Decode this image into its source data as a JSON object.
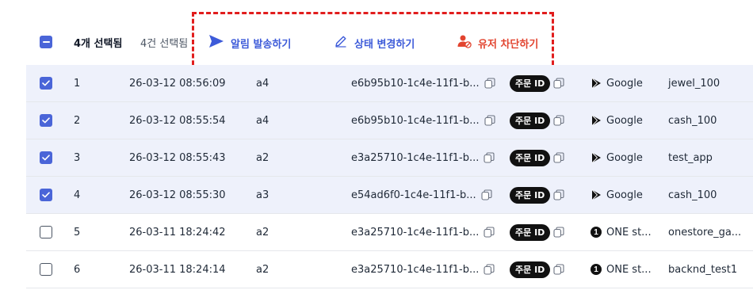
{
  "toolbar": {
    "selected_count": "4개 선택됨",
    "total_selected": "4건 선택됨",
    "actions": {
      "send_notification": "알림 발송하기",
      "change_status": "상태 변경하기",
      "block_user": "유저 차단하기"
    },
    "colors": {
      "primary": "#3d5bd9",
      "danger": "#e2442f",
      "highlight_border": "#e11d1d"
    }
  },
  "rows": [
    {
      "selected": true,
      "num": "1",
      "date": "26-03-12 08:56:09",
      "user": "a4",
      "tx": "e6b95b10-1c4e-11f1-b...",
      "order_badge": "주문 ID",
      "store_icon": "google-play-icon",
      "store": "Google",
      "product": "jewel_100"
    },
    {
      "selected": true,
      "num": "2",
      "date": "26-03-12 08:55:54",
      "user": "a4",
      "tx": "e6b95b10-1c4e-11f1-b...",
      "order_badge": "주문 ID",
      "store_icon": "google-play-icon",
      "store": "Google",
      "product": "cash_100"
    },
    {
      "selected": true,
      "num": "3",
      "date": "26-03-12 08:55:43",
      "user": "a2",
      "tx": "e3a25710-1c4e-11f1-b...",
      "order_badge": "주문 ID",
      "store_icon": "google-play-icon",
      "store": "Google",
      "product": "test_app"
    },
    {
      "selected": true,
      "num": "4",
      "date": "26-03-12 08:55:30",
      "user": "a3",
      "tx": "e54ad6f0-1c4e-11f1-b...",
      "order_badge": "주문 ID",
      "store_icon": "google-play-icon",
      "store": "Google",
      "product": "cash_100"
    },
    {
      "selected": false,
      "num": "5",
      "date": "26-03-11 18:24:42",
      "user": "a2",
      "tx": "e3a25710-1c4e-11f1-b...",
      "order_badge": "주문 ID",
      "store_icon": "one-store-icon",
      "store": "ONE st...",
      "product": "onestore_ga..."
    },
    {
      "selected": false,
      "num": "6",
      "date": "26-03-11 18:24:14",
      "user": "a2",
      "tx": "e3a25710-1c4e-11f1-b...",
      "order_badge": "주문 ID",
      "store_icon": "one-store-icon",
      "store": "ONE st...",
      "product": "backnd_test1"
    }
  ]
}
